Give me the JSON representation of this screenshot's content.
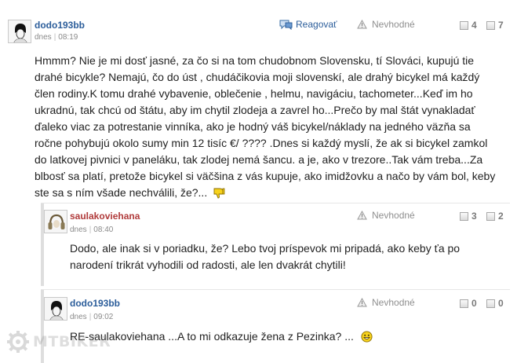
{
  "comments": [
    {
      "author": "dodo193bb",
      "date": "dnes",
      "time": "08:19",
      "reply_label": "Reagovať",
      "flag_label": "Nevhodné",
      "likes": "4",
      "dislikes": "7",
      "text_lines": [
        "Hmmm? Nie je mi dosť jasné, za čo si na tom chudobnom Slovensku, tí Slováci, kupujú tie",
        "drahé bicykle? Nemajú, čo do úst , chudáčikovia moji slovenskí, ale drahý bicykel má každý",
        "člen rodiny.K tomu drahé vybavenie, oblečenie , helmu, navigáciu, tachometer...Keď im ho",
        "ukradnú, tak chcú od štátu, aby im chytil zlodeja a zavrel ho...Prečo by mal štát vynakladať",
        "ďaleko viac za potrestanie vinníka, ako je hodný váš bicykel/náklady na jedného väzňa sa",
        "ročne pohybujú okolo sumy min 12 tisíc €/ ???? .Dnes si každý myslí, že ak si bicykel zamkol",
        "do latkovej pivnici v paneláku, tak zlodej nemá šancu. a je, ako v trezore..Tak vám treba...Za",
        "blbosť sa platí, pretože bicykel si väčšina z vás kupuje, ako imidžovku a načo by vám bol, keby",
        "ste sa s ním všade nechválili, že?..."
      ]
    },
    {
      "author": "saulakoviehana",
      "date": "dnes",
      "time": "08:40",
      "flag_label": "Nevhodné",
      "likes": "3",
      "dislikes": "2",
      "text_lines": [
        "Dodo, ale inak si v poriadku, že? Lebo tvoj príspevok mi pripadá, ako keby ťa po",
        "narodení trikrát vyhodili od radosti, ale len dvakrát chytili!"
      ]
    },
    {
      "author": "dodo193bb",
      "date": "dnes",
      "time": "09:02",
      "flag_label": "Nevhodné",
      "likes": "0",
      "dislikes": "0",
      "text_lines": [
        "RE-saulakoviehana ...A to mi odkazuje žena z Pezinka? ..."
      ]
    }
  ],
  "watermark": "MTBIKER",
  "colors": {
    "author_blue": "#2b5d9a",
    "author_red": "#b03a3a",
    "meta_gray": "#8a8a8a",
    "text": "#222222"
  },
  "icons": {
    "reply": "speech-bubble-icon",
    "flag": "warning-triangle-icon",
    "like": "vote-up-box-icon",
    "dislike": "vote-down-box-icon",
    "thumbs_down": "thumbs-down-emoji-icon",
    "smile": "smile-emoji-icon"
  }
}
